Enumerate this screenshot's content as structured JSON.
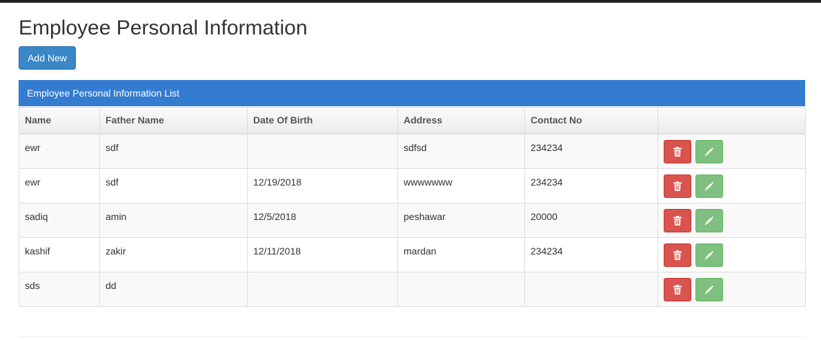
{
  "page": {
    "title": "Employee Personal Information",
    "add_button_label": "Add New"
  },
  "panel": {
    "heading": "Employee Personal Information List"
  },
  "table": {
    "columns": [
      "Name",
      "Father Name",
      "Date Of Birth",
      "Address",
      "Contact No",
      ""
    ],
    "rows": [
      {
        "name": "ewr",
        "father_name": "sdf",
        "dob": "",
        "address": "sdfsd",
        "contact": "234234"
      },
      {
        "name": "ewr",
        "father_name": "sdf",
        "dob": "12/19/2018",
        "address": "wwwwwww",
        "contact": "234234"
      },
      {
        "name": "sadiq",
        "father_name": "amin",
        "dob": "12/5/2018",
        "address": "peshawar",
        "contact": "20000"
      },
      {
        "name": "kashif",
        "father_name": "zakir",
        "dob": "12/11/2018",
        "address": "mardan",
        "contact": "234234"
      },
      {
        "name": "sds",
        "father_name": "dd",
        "dob": "",
        "address": "",
        "contact": ""
      }
    ],
    "row_actions": [
      "trash-icon",
      "pencil-icon"
    ]
  },
  "colors": {
    "primary": "#337ccf",
    "danger": "#d9534f",
    "success": "#7fbf7f"
  }
}
